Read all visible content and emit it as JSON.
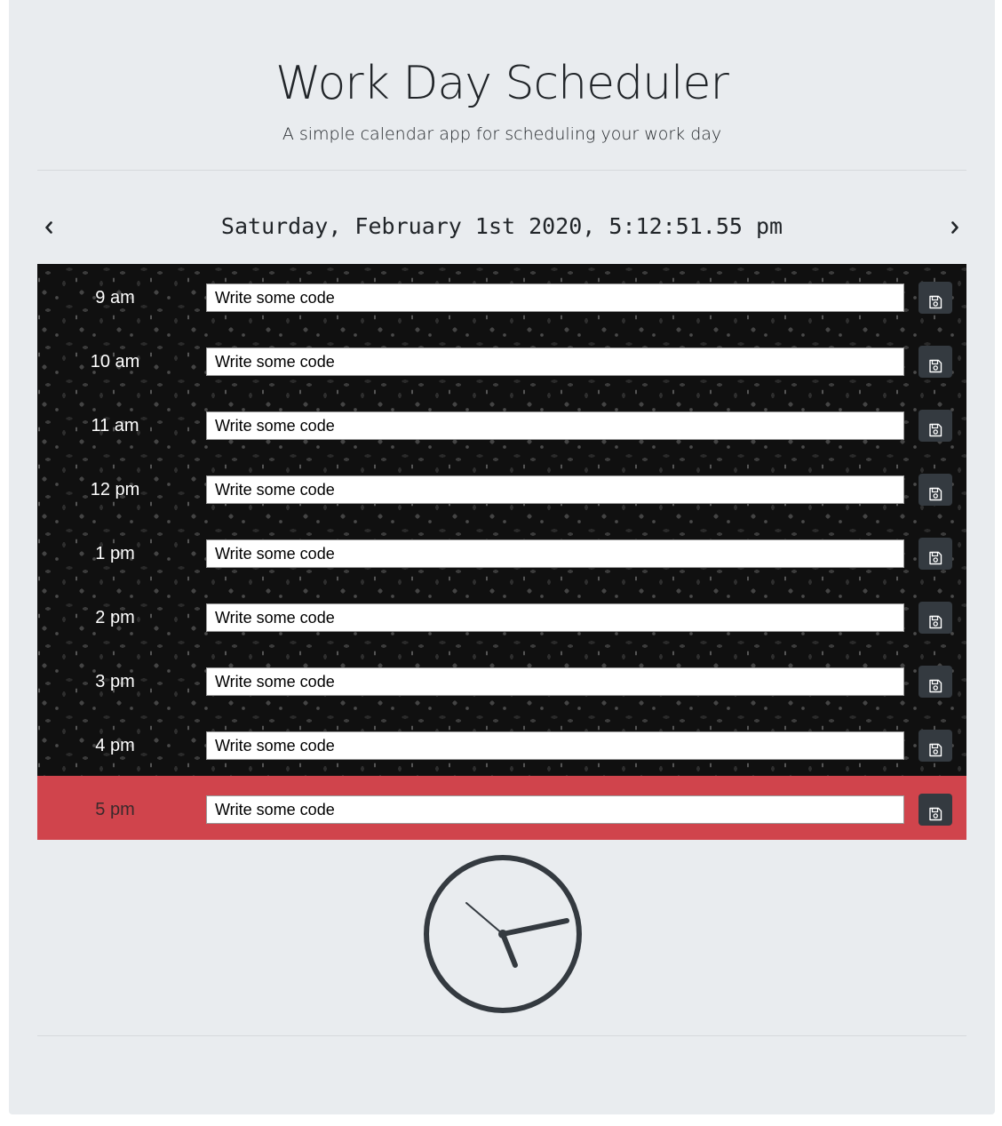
{
  "header": {
    "title": "Work Day Scheduler",
    "subtitle": "A simple calendar app for scheduling your work day"
  },
  "datebar": {
    "prev_icon": "chevron-left-icon",
    "next_icon": "chevron-right-icon",
    "current_date": "Saturday, February 1st 2020, 5:12:51.55 pm"
  },
  "schedule": {
    "save_icon": "floppy-disk-icon",
    "rows": [
      {
        "hour": "9 am",
        "task": "Write some code",
        "status": "past"
      },
      {
        "hour": "10 am",
        "task": "Write some code",
        "status": "past"
      },
      {
        "hour": "11 am",
        "task": "Write some code",
        "status": "past"
      },
      {
        "hour": "12 pm",
        "task": "Write some code",
        "status": "past"
      },
      {
        "hour": "1 pm",
        "task": "Write some code",
        "status": "past"
      },
      {
        "hour": "2 pm",
        "task": "Write some code",
        "status": "past"
      },
      {
        "hour": "3 pm",
        "task": "Write some code",
        "status": "past"
      },
      {
        "hour": "4 pm",
        "task": "Write some code",
        "status": "past"
      },
      {
        "hour": "5 pm",
        "task": "Write some code",
        "status": "present"
      }
    ]
  },
  "clock": {
    "icon": "analog-clock-icon",
    "time": "5:12:51"
  },
  "colors": {
    "page_background": "#e9ecef",
    "present_row": "#d0444c",
    "past_row_texture": "#101010",
    "save_button": "#343a40",
    "clock_stroke": "#343a40"
  }
}
